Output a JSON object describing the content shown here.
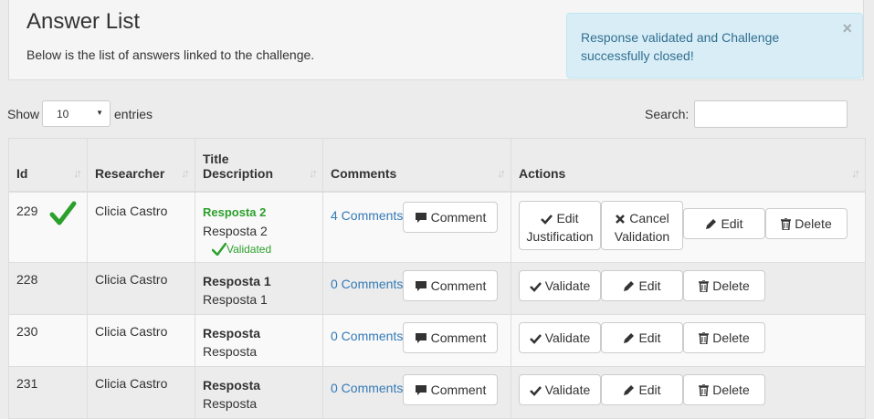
{
  "header": {
    "title": "Answer List",
    "subtitle": "Below is the list of answers linked to the challenge."
  },
  "alert": {
    "message": "Response validated and Challenge successfully closed!",
    "close": "×",
    "bg_color": "#d9edf7",
    "text_color": "#31708f"
  },
  "controls": {
    "show_label": "Show",
    "entries_value": "10",
    "entries_label": "entries",
    "search_label": "Search:",
    "search_value": ""
  },
  "table": {
    "headers": {
      "id": "Id",
      "researcher": "Researcher",
      "title_line1": "Title",
      "title_line2": "Description",
      "comments": "Comments",
      "actions": "Actions"
    },
    "rows": [
      {
        "id": "229",
        "researcher": "Clicia Castro",
        "title": "Resposta 2",
        "description": "Resposta 2",
        "status": "Validated",
        "comments_link": "4 Comments",
        "comment_btn": "Comment",
        "action1_line1": "Edit",
        "action1_line2": "Justification",
        "action2_line1": "Cancel",
        "action2_line2": "Validation",
        "edit_btn": "Edit",
        "delete_btn": "Delete"
      },
      {
        "id": "228",
        "researcher": "Clicia Castro",
        "title": "Resposta 1",
        "description": "Resposta 1",
        "comments_link": "0 Comments",
        "comment_btn": "Comment",
        "validate_btn": "Validate",
        "edit_btn": "Edit",
        "delete_btn": "Delete"
      },
      {
        "id": "230",
        "researcher": "Clicia Castro",
        "title": "Resposta",
        "description": "Resposta",
        "comments_link": "0 Comments",
        "comment_btn": "Comment",
        "validate_btn": "Validate",
        "edit_btn": "Edit",
        "delete_btn": "Delete"
      },
      {
        "id": "231",
        "researcher": "Clicia Castro",
        "title": "Resposta",
        "description": "Resposta",
        "comments_link": "0 Comments",
        "comment_btn": "Comment",
        "validate_btn": "Validate",
        "edit_btn": "Edit",
        "delete_btn": "Delete"
      }
    ]
  },
  "colors": {
    "validated_green": "#2ca02c",
    "link_blue": "#337ab7"
  },
  "icons": [
    "check-icon",
    "comment-icon",
    "pencil-icon",
    "trash-icon",
    "times-icon",
    "sort-icon",
    "caret-down-icon"
  ]
}
